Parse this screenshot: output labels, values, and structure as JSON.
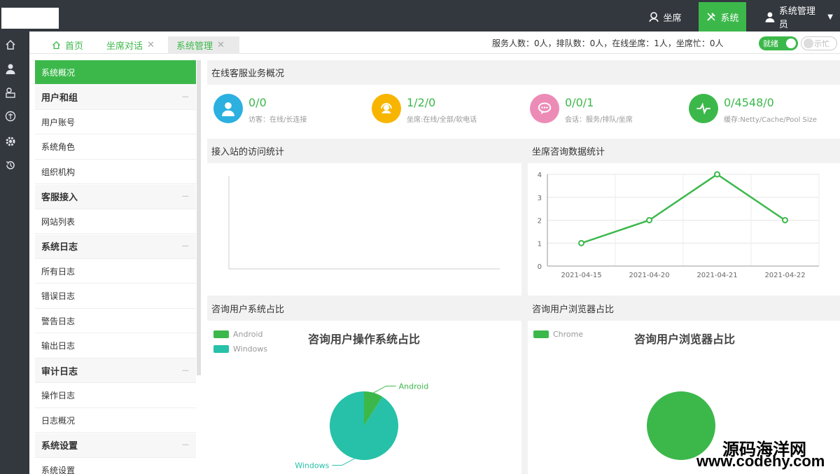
{
  "topbar": {
    "seat_label": "坐席",
    "system_label": "系统",
    "user_label": "系统管理员"
  },
  "tabs": [
    {
      "label": "首页"
    },
    {
      "label": "坐席对话"
    },
    {
      "label": "系统管理"
    }
  ],
  "status": {
    "text": "服务人数：0人，排队数：0人，在线坐席：1人，坐席忙：0人",
    "ready_label": "就绪",
    "busy_label": "示忙"
  },
  "sidebar": {
    "items": [
      {
        "label": "系统概况",
        "type": "active"
      },
      {
        "label": "用户和组",
        "type": "group"
      },
      {
        "label": "用户账号",
        "type": "item"
      },
      {
        "label": "系统角色",
        "type": "item"
      },
      {
        "label": "组织机构",
        "type": "item"
      },
      {
        "label": "客服接入",
        "type": "group"
      },
      {
        "label": "网站列表",
        "type": "item"
      },
      {
        "label": "系统日志",
        "type": "group"
      },
      {
        "label": "所有日志",
        "type": "item"
      },
      {
        "label": "错误日志",
        "type": "item"
      },
      {
        "label": "警告日志",
        "type": "item"
      },
      {
        "label": "输出日志",
        "type": "item"
      },
      {
        "label": "审计日志",
        "type": "group"
      },
      {
        "label": "操作日志",
        "type": "item"
      },
      {
        "label": "日志概况",
        "type": "item"
      },
      {
        "label": "系统设置",
        "type": "group"
      },
      {
        "label": "系统设置",
        "type": "item"
      }
    ]
  },
  "overview": {
    "title": "在线客服业务概况",
    "kpis": [
      {
        "value": "0/0",
        "sub": "访客：在线/长连接",
        "color": "#2bb0e0",
        "icon": "user-icon"
      },
      {
        "value": "1/2/0",
        "sub": "坐席:在线/全部/软电话",
        "color": "#f7b500",
        "icon": "headset-icon"
      },
      {
        "value": "0/0/1",
        "sub": "会话：服务/排队/坐席",
        "color": "#ec8cb6",
        "icon": "chat-icon"
      },
      {
        "value": "0/4548/0",
        "sub": "缓存:Netty/Cache/Pool Size",
        "color": "#3cb84b",
        "icon": "pulse-icon"
      }
    ]
  },
  "panels": {
    "visits_title": "接入站的访问统计",
    "consult_title": "坐席咨询数据统计",
    "os_title": "咨询用户系统占比",
    "browser_title": "咨询用户浏览器占比"
  },
  "chart_data": [
    {
      "type": "line",
      "title": "",
      "x": [
        "2021-04-15",
        "2021-04-20",
        "2021-04-21",
        "2021-04-22"
      ],
      "series": [
        {
          "values": [
            1,
            2,
            4,
            2
          ]
        }
      ],
      "ylim": [
        0,
        4
      ],
      "yticks": [
        0,
        1,
        2,
        3,
        4
      ],
      "grid": true,
      "color": "#3cb84b"
    },
    {
      "type": "pie",
      "title": "咨询用户操作系统占比",
      "legend": [
        "Android",
        "Windows"
      ],
      "slices": [
        {
          "name": "Android",
          "value": 0.09,
          "color": "#3cb84b"
        },
        {
          "name": "Windows",
          "value": 0.91,
          "color": "#26c1a8"
        }
      ],
      "legend_position": "top-left"
    },
    {
      "type": "pie",
      "title": "咨询用户浏览器占比",
      "legend": [
        "Chrome"
      ],
      "slices": [
        {
          "name": "Chrome",
          "value": 1.0,
          "color": "#3cb84b"
        }
      ],
      "legend_position": "top-left"
    }
  ],
  "watermark": {
    "line1": "源码海洋网",
    "line2": "www.codehy.com"
  }
}
